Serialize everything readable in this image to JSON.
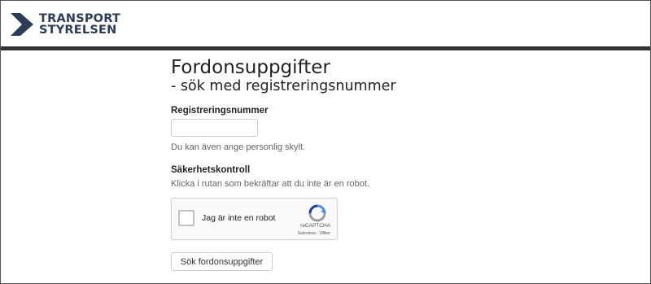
{
  "header": {
    "logo_line1": "TRANSPORT",
    "logo_line2": "STYRELSEN",
    "logo_icon": "transportstyrelsen-logo-icon"
  },
  "form": {
    "title": "Fordonsuppgifter",
    "subtitle": "- sök med registreringsnummer",
    "reg_label": "Registreringsnummer",
    "reg_value": "",
    "reg_help": "Du kan även ange personlig skylt.",
    "security_label": "Säkerhetskontroll",
    "security_help": "Klicka i rutan som bekräftar att du inte är en robot.",
    "search_button": "Sök fordonsuppgifter"
  },
  "captcha": {
    "checkbox_label": "Jag är inte en robot",
    "brand": "reCAPTCHA",
    "links": "Sekretess - Villkor",
    "icon": "recaptcha-icon"
  },
  "colors": {
    "logo_navy": "#2c3e57",
    "divider": "#353535",
    "recaptcha_blue": "#4a90e2",
    "recaptcha_gray": "#9e9e9e"
  }
}
